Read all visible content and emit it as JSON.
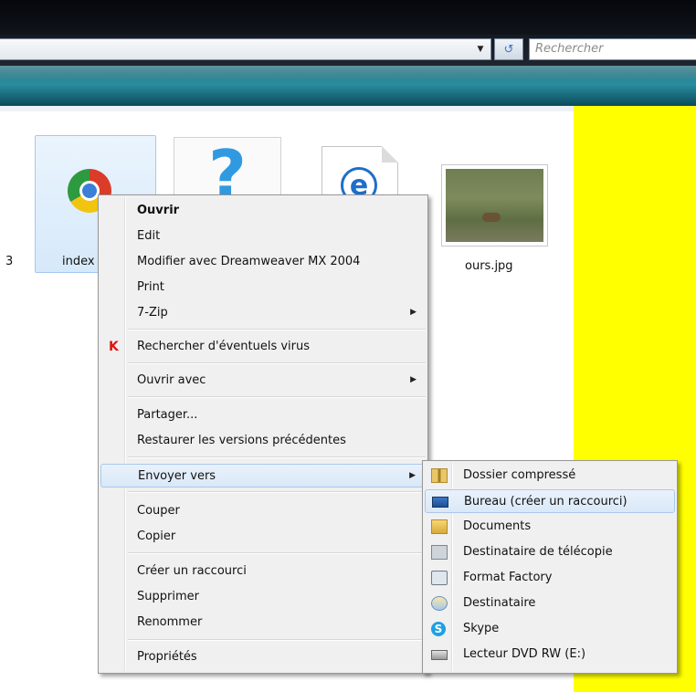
{
  "explorer": {
    "search_placeholder": "Rechercher",
    "left_number": "3",
    "files": [
      {
        "label": "index",
        "icon": "chrome-icon"
      },
      {
        "label": "",
        "icon": "question-mark-icon"
      },
      {
        "label": "",
        "icon": "internet-explorer-document-icon"
      },
      {
        "label": "ours.jpg",
        "icon": "image-thumbnail"
      }
    ],
    "refresh_glyph": "↺",
    "dropdown_glyph": "▼"
  },
  "context_menu": {
    "items": [
      {
        "label": "Ouvrir",
        "bold": true
      },
      {
        "label": "Edit"
      },
      {
        "label": "Modifier avec Dreamweaver MX 2004"
      },
      {
        "label": "Print"
      },
      {
        "label": "7-Zip",
        "submenu": true
      },
      {
        "label": "Rechercher d'éventuels virus",
        "icon": "kaspersky-icon"
      },
      {
        "label": "Ouvrir avec",
        "submenu": true
      },
      {
        "label": "Partager..."
      },
      {
        "label": "Restaurer les versions précédentes"
      },
      {
        "label": "Envoyer vers",
        "submenu": true,
        "highlighted": true
      },
      {
        "label": "Couper"
      },
      {
        "label": "Copier"
      },
      {
        "label": "Créer un raccourci"
      },
      {
        "label": "Supprimer"
      },
      {
        "label": "Renommer"
      },
      {
        "label": "Propriétés"
      }
    ],
    "arrow_glyph": "▶",
    "kaspersky_glyph": "K"
  },
  "send_to_submenu": {
    "items": [
      {
        "label": "Dossier compressé",
        "icon": "zip-folder-icon"
      },
      {
        "label": "Bureau (créer un raccourci)",
        "icon": "desktop-icon",
        "highlighted": true
      },
      {
        "label": "Documents",
        "icon": "documents-folder-icon"
      },
      {
        "label": "Destinataire de télécopie",
        "icon": "fax-icon"
      },
      {
        "label": "Format Factory",
        "icon": "format-factory-icon"
      },
      {
        "label": "Destinataire",
        "icon": "mail-recipient-icon"
      },
      {
        "label": "Skype",
        "icon": "skype-icon"
      },
      {
        "label": "Lecteur DVD RW (E:)",
        "icon": "dvd-drive-icon"
      }
    ],
    "skype_glyph": "S"
  },
  "colors": {
    "toolbar": "#1b7688",
    "background_right": "#ffff00",
    "menu_background": "#f0f0f0",
    "highlight": "#d9e8f8"
  }
}
